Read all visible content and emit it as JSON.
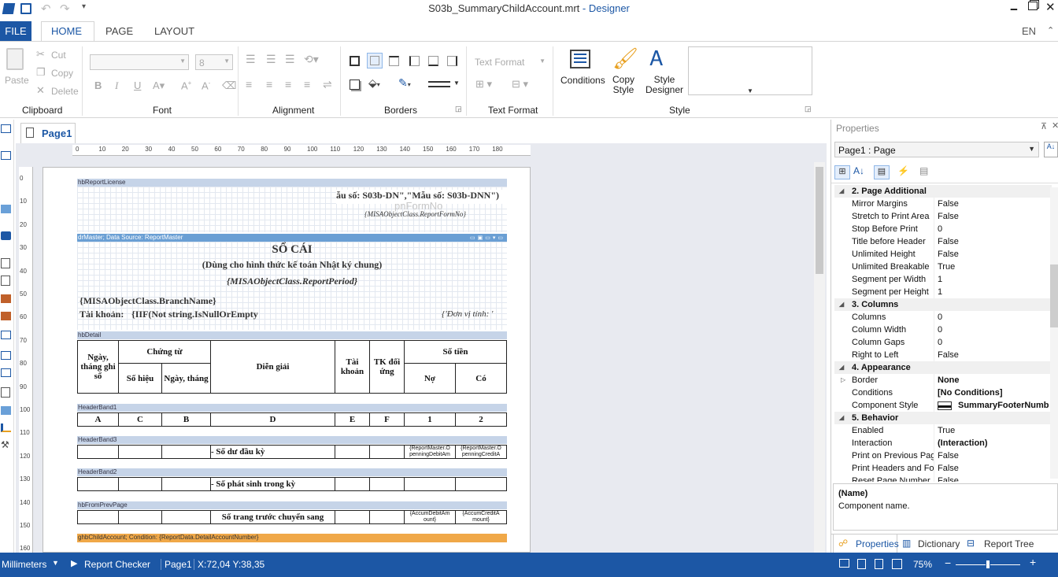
{
  "window": {
    "title": "S03b_SummaryChildAccount.mrt",
    "app": " - Designer"
  },
  "menu": {
    "file": "FILE",
    "tabs": [
      "HOME",
      "PAGE",
      "LAYOUT"
    ],
    "lang": "EN"
  },
  "ribbon": {
    "clipboard": {
      "paste": "Paste",
      "cut": "Cut",
      "copy": "Copy",
      "delete": "Delete",
      "label": "Clipboard"
    },
    "font": {
      "size": "8",
      "label": "Font"
    },
    "alignment": {
      "label": "Alignment"
    },
    "borders": {
      "label": "Borders"
    },
    "text_format": {
      "field": "Text Format",
      "label": "Text Format"
    },
    "style": {
      "conditions": "Conditions",
      "copy_style_1": "Copy",
      "copy_style_2": "Style",
      "style_designer_1": "Style",
      "style_designer_2": "Designer",
      "label": "Style"
    }
  },
  "doc": {
    "tab": "Page1"
  },
  "ruler": {
    "top": [
      "0",
      "10",
      "20",
      "30",
      "40",
      "50",
      "60",
      "70",
      "80",
      "90",
      "100",
      "110",
      "120",
      "130",
      "140",
      "150",
      "160",
      "170",
      "180"
    ],
    "left": [
      "0",
      "10",
      "20",
      "30",
      "40",
      "50",
      "60",
      "70",
      "80",
      "90",
      "100",
      "110",
      "120",
      "130",
      "140",
      "150",
      "160"
    ]
  },
  "report": {
    "band_license": "hbReportLicense",
    "form_no": "ẫu số: S03b-DN\",\"Mẫu số: S03b-DNN\")",
    "form_ph": "pnFormNo",
    "form_expr": "{MISAObjectClass.ReportFormNo}",
    "band_master": "drMaster; Data Source: ReportMaster",
    "title": "SỔ CÁI",
    "subtitle": "(Dùng cho hình thức kế toán Nhật ký chung)",
    "period": "{MISAObjectClass.ReportPeriod}",
    "branch": "{MISAObjectClass.BranchName}",
    "account_label": "Tài khoản:",
    "account_expr": "{IIF(Not string.IsNullOrEmpty",
    "unit": "{'Đơn vị tính: '",
    "band_detail": "hbDetail",
    "h_date": "Ngày, tháng ghi sổ",
    "h_voucher": "Chứng từ",
    "h_vno": "Số hiệu",
    "h_vdate": "Ngày, tháng",
    "h_desc": "Diễn giải",
    "h_acc": "Tài khoản",
    "h_corr": "TK đối ứng",
    "h_amount": "Số tiền",
    "h_debit": "Nợ",
    "h_credit": "Có",
    "band_h1": "HeaderBand1",
    "codes": [
      "A",
      "C",
      "B",
      "D",
      "E",
      "F",
      "1",
      "2"
    ],
    "band_h3": "HeaderBand3",
    "opening": "- Số dư đầu kỳ",
    "open_debit": "{ReportMaster.O penningDebitAm",
    "open_credit": "{ReportMaster.O penningCreditA",
    "band_h2": "HeaderBand2",
    "arising": "- Số phát sinh trong kỳ",
    "band_prev": "hbFromPrevPage",
    "carried": "Số trang trước chuyển sang",
    "accum_debit": "{AccumDebitAm ount}",
    "accum_credit": "{AccumCreditA mount}",
    "band_child": "ghbChildAccount; Condition: {ReportData.DetailAccountNumber}"
  },
  "properties": {
    "header": "Properties",
    "selector": "Page1 : Page",
    "rows": [
      {
        "cat": true,
        "name": "2. Page  Additional"
      },
      {
        "name": "Mirror Margins",
        "val": "False"
      },
      {
        "name": "Stretch to Print Area",
        "val": "False"
      },
      {
        "name": "Stop Before Print",
        "val": "0"
      },
      {
        "name": "Title before Header",
        "val": "False"
      },
      {
        "name": "Unlimited Height",
        "val": "False"
      },
      {
        "name": "Unlimited Breakable",
        "val": "True"
      },
      {
        "name": "Segment per Width",
        "val": "1"
      },
      {
        "name": "Segment per Height",
        "val": "1"
      },
      {
        "cat": true,
        "name": "3. Columns"
      },
      {
        "name": "Columns",
        "val": "0"
      },
      {
        "name": "Column Width",
        "val": "0"
      },
      {
        "name": "Column Gaps",
        "val": "0"
      },
      {
        "name": "Right to Left",
        "val": "False"
      },
      {
        "cat": true,
        "name": "4. Appearance"
      },
      {
        "name": "Border",
        "val": "None",
        "bold": true,
        "exp": true
      },
      {
        "name": "Conditions",
        "val": "[No Conditions]",
        "bold": true
      },
      {
        "name": "Component Style",
        "val": "SummaryFooterNumb",
        "bold": true,
        "swatch": true
      },
      {
        "cat": true,
        "name": "5. Behavior"
      },
      {
        "name": "Enabled",
        "val": "True"
      },
      {
        "name": "Interaction",
        "val": "(Interaction)",
        "bold": true
      },
      {
        "name": "Print on Previous Pag",
        "val": "False"
      },
      {
        "name": "Print Headers and Fo",
        "val": "False"
      },
      {
        "name": "Reset Page Number",
        "val": "False"
      }
    ],
    "desc_title": "(Name)",
    "desc_text": "Component name.",
    "tabs": [
      "Properties",
      "Dictionary",
      "Report Tree"
    ]
  },
  "status": {
    "units": "Millimeters",
    "checker": "Report Checker",
    "page": "Page1",
    "coords": "X:72,04  Y:38,35",
    "zoom": "75%",
    "zoom_level": 0.5
  },
  "colors": {
    "accent": "#1c57a5",
    "band": "#c6d4e8",
    "child_band": "#f0a848"
  }
}
